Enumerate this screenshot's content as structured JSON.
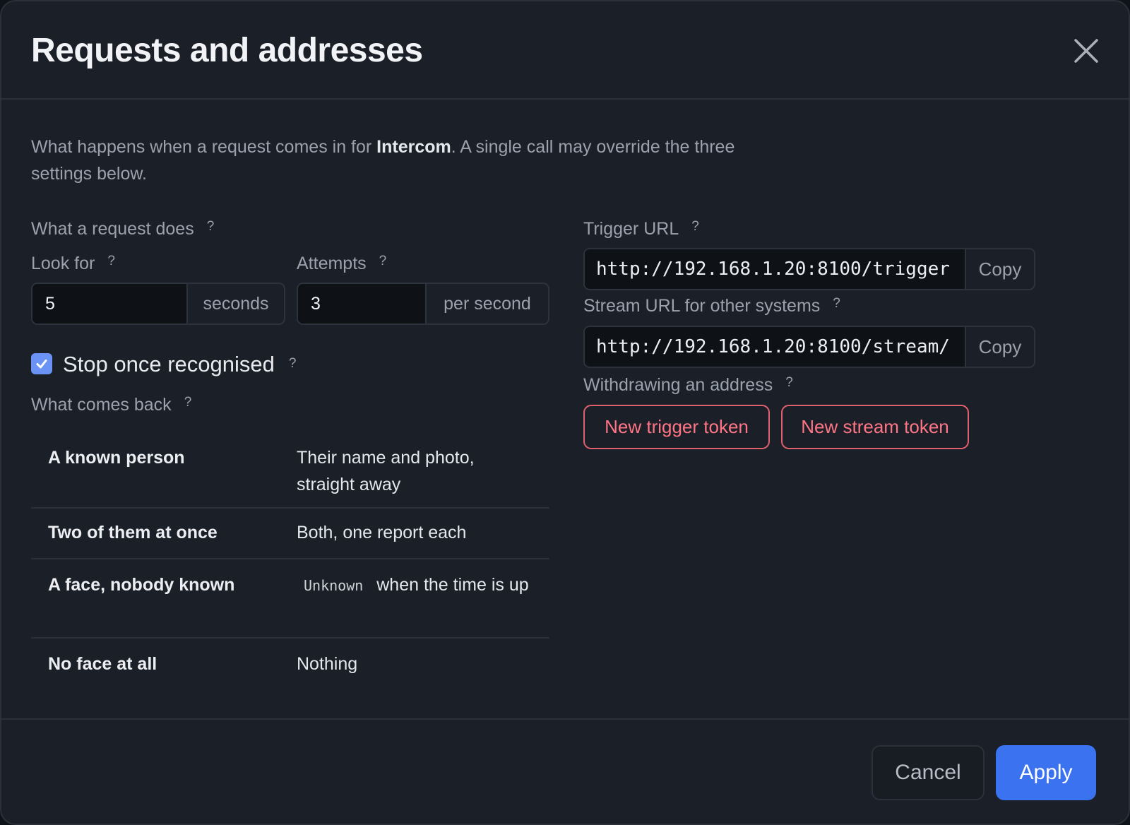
{
  "dialog": {
    "title": "Requests and addresses",
    "description_before": "What happens when a request comes in for ",
    "description_bold": "Intercom",
    "description_after": ". A single call may override the three settings below."
  },
  "left": {
    "section_label": "What a request does",
    "look_for": {
      "label": "Look for",
      "value": "5",
      "suffix": "seconds"
    },
    "attempts": {
      "label": "Attempts",
      "value": "3",
      "suffix": "per second"
    },
    "stop_checkbox": {
      "label": "Stop once recognised",
      "checked": true
    },
    "returns_label": "What comes back",
    "returns": [
      {
        "case": "A known person",
        "result": "Their name and photo, straight away"
      },
      {
        "case": "Two of them at once",
        "result": "Both, one report each"
      },
      {
        "case": "A face, nobody known",
        "code": "Unknown",
        "result": "when the time is up"
      },
      {
        "case": "No face at all",
        "result": "Nothing"
      }
    ]
  },
  "right": {
    "trigger": {
      "label": "Trigger URL",
      "url": "http://192.168.1.20:8100/trigger",
      "copy": "Copy"
    },
    "stream": {
      "label": "Stream URL for other systems",
      "url": "http://192.168.1.20:8100/stream/",
      "copy": "Copy"
    },
    "withdraw_label": "Withdrawing an address",
    "new_trigger_token": "New trigger token",
    "new_stream_token": "New stream token"
  },
  "help_glyph": "?",
  "footer": {
    "cancel": "Cancel",
    "apply": "Apply"
  },
  "colors": {
    "accent": "#3a72f0",
    "danger": "#ff7585",
    "checkbox": "#6b93f5",
    "background": "#1b1f27"
  }
}
